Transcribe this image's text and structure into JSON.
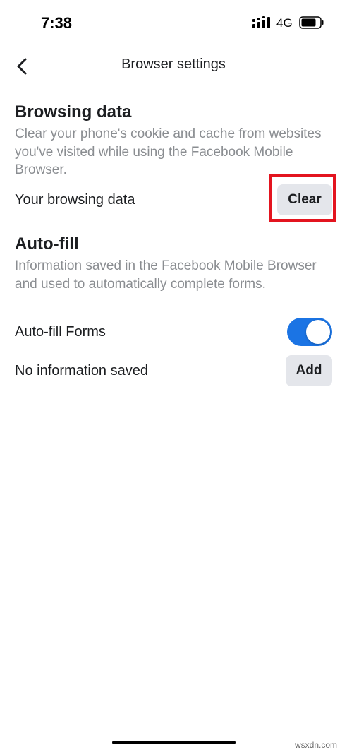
{
  "status_bar": {
    "time": "7:38",
    "network": "4G",
    "signal_icon": "signal-bars-icon",
    "battery_icon": "battery-icon"
  },
  "nav": {
    "back_icon": "chevron-left-icon",
    "title": "Browser settings"
  },
  "browsing_data": {
    "heading": "Browsing data",
    "description": "Clear your phone's cookie and cache from websites you've visited while using the Facebook Mobile Browser.",
    "row_label": "Your browsing data",
    "clear_label": "Clear",
    "highlight_color": "#e3141f"
  },
  "autofill": {
    "heading": "Auto-fill",
    "description": "Information saved in the Facebook Mobile Browser and used to automatically complete forms.",
    "forms_label": "Auto-fill Forms",
    "forms_enabled": true,
    "saved_label": "No information saved",
    "add_label": "Add"
  },
  "colors": {
    "accent": "#1b74e4",
    "button_bg": "#e4e6eb",
    "secondary_text": "#8a8d91"
  },
  "watermark": "wsxdn.com"
}
